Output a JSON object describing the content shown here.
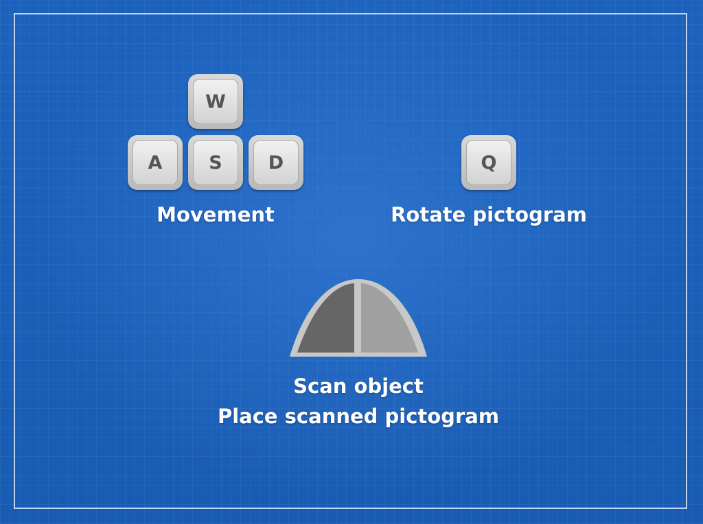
{
  "controls": {
    "movement": {
      "keys": {
        "w": "W",
        "a": "A",
        "s": "S",
        "d": "D"
      },
      "label": "Movement"
    },
    "rotate": {
      "key": "Q",
      "label": "Rotate pictogram"
    },
    "mouse": {
      "icon": "mouse-buttons-icon",
      "left_button_label": "Scan object",
      "right_button_label": "Place scanned pictogram"
    }
  },
  "colors": {
    "background": "#1a5fb4",
    "frame": "#e1ebfa",
    "key_face": "#e6e6e6",
    "key_text": "#555555",
    "mouse_left": "#666666",
    "mouse_right": "#a0a0a0",
    "mouse_outline": "#c8c8c8",
    "label_text": "#ffffff"
  }
}
